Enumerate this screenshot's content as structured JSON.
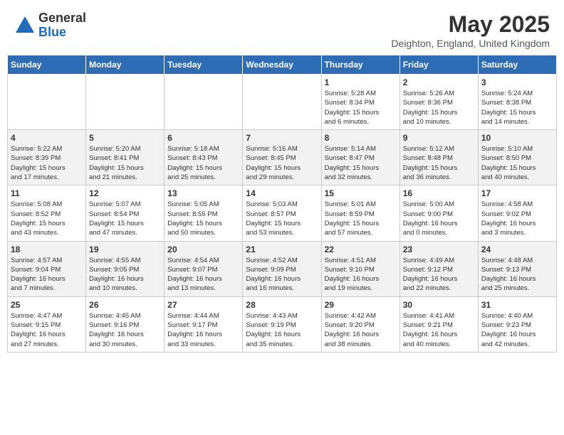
{
  "header": {
    "logo_general": "General",
    "logo_blue": "Blue",
    "title": "May 2025",
    "location": "Deighton, England, United Kingdom"
  },
  "days_of_week": [
    "Sunday",
    "Monday",
    "Tuesday",
    "Wednesday",
    "Thursday",
    "Friday",
    "Saturday"
  ],
  "weeks": [
    [
      {
        "num": "",
        "info": ""
      },
      {
        "num": "",
        "info": ""
      },
      {
        "num": "",
        "info": ""
      },
      {
        "num": "",
        "info": ""
      },
      {
        "num": "1",
        "info": "Sunrise: 5:28 AM\nSunset: 8:34 PM\nDaylight: 15 hours\nand 6 minutes."
      },
      {
        "num": "2",
        "info": "Sunrise: 5:26 AM\nSunset: 8:36 PM\nDaylight: 15 hours\nand 10 minutes."
      },
      {
        "num": "3",
        "info": "Sunrise: 5:24 AM\nSunset: 8:38 PM\nDaylight: 15 hours\nand 14 minutes."
      }
    ],
    [
      {
        "num": "4",
        "info": "Sunrise: 5:22 AM\nSunset: 8:39 PM\nDaylight: 15 hours\nand 17 minutes."
      },
      {
        "num": "5",
        "info": "Sunrise: 5:20 AM\nSunset: 8:41 PM\nDaylight: 15 hours\nand 21 minutes."
      },
      {
        "num": "6",
        "info": "Sunrise: 5:18 AM\nSunset: 8:43 PM\nDaylight: 15 hours\nand 25 minutes."
      },
      {
        "num": "7",
        "info": "Sunrise: 5:16 AM\nSunset: 8:45 PM\nDaylight: 15 hours\nand 29 minutes."
      },
      {
        "num": "8",
        "info": "Sunrise: 5:14 AM\nSunset: 8:47 PM\nDaylight: 15 hours\nand 32 minutes."
      },
      {
        "num": "9",
        "info": "Sunrise: 5:12 AM\nSunset: 8:48 PM\nDaylight: 15 hours\nand 36 minutes."
      },
      {
        "num": "10",
        "info": "Sunrise: 5:10 AM\nSunset: 8:50 PM\nDaylight: 15 hours\nand 40 minutes."
      }
    ],
    [
      {
        "num": "11",
        "info": "Sunrise: 5:08 AM\nSunset: 8:52 PM\nDaylight: 15 hours\nand 43 minutes."
      },
      {
        "num": "12",
        "info": "Sunrise: 5:07 AM\nSunset: 8:54 PM\nDaylight: 15 hours\nand 47 minutes."
      },
      {
        "num": "13",
        "info": "Sunrise: 5:05 AM\nSunset: 8:55 PM\nDaylight: 15 hours\nand 50 minutes."
      },
      {
        "num": "14",
        "info": "Sunrise: 5:03 AM\nSunset: 8:57 PM\nDaylight: 15 hours\nand 53 minutes."
      },
      {
        "num": "15",
        "info": "Sunrise: 5:01 AM\nSunset: 8:59 PM\nDaylight: 15 hours\nand 57 minutes."
      },
      {
        "num": "16",
        "info": "Sunrise: 5:00 AM\nSunset: 9:00 PM\nDaylight: 16 hours\nand 0 minutes."
      },
      {
        "num": "17",
        "info": "Sunrise: 4:58 AM\nSunset: 9:02 PM\nDaylight: 16 hours\nand 3 minutes."
      }
    ],
    [
      {
        "num": "18",
        "info": "Sunrise: 4:57 AM\nSunset: 9:04 PM\nDaylight: 16 hours\nand 7 minutes."
      },
      {
        "num": "19",
        "info": "Sunrise: 4:55 AM\nSunset: 9:05 PM\nDaylight: 16 hours\nand 10 minutes."
      },
      {
        "num": "20",
        "info": "Sunrise: 4:54 AM\nSunset: 9:07 PM\nDaylight: 16 hours\nand 13 minutes."
      },
      {
        "num": "21",
        "info": "Sunrise: 4:52 AM\nSunset: 9:09 PM\nDaylight: 16 hours\nand 16 minutes."
      },
      {
        "num": "22",
        "info": "Sunrise: 4:51 AM\nSunset: 9:10 PM\nDaylight: 16 hours\nand 19 minutes."
      },
      {
        "num": "23",
        "info": "Sunrise: 4:49 AM\nSunset: 9:12 PM\nDaylight: 16 hours\nand 22 minutes."
      },
      {
        "num": "24",
        "info": "Sunrise: 4:48 AM\nSunset: 9:13 PM\nDaylight: 16 hours\nand 25 minutes."
      }
    ],
    [
      {
        "num": "25",
        "info": "Sunrise: 4:47 AM\nSunset: 9:15 PM\nDaylight: 16 hours\nand 27 minutes."
      },
      {
        "num": "26",
        "info": "Sunrise: 4:45 AM\nSunset: 9:16 PM\nDaylight: 16 hours\nand 30 minutes."
      },
      {
        "num": "27",
        "info": "Sunrise: 4:44 AM\nSunset: 9:17 PM\nDaylight: 16 hours\nand 33 minutes."
      },
      {
        "num": "28",
        "info": "Sunrise: 4:43 AM\nSunset: 9:19 PM\nDaylight: 16 hours\nand 35 minutes."
      },
      {
        "num": "29",
        "info": "Sunrise: 4:42 AM\nSunset: 9:20 PM\nDaylight: 16 hours\nand 38 minutes."
      },
      {
        "num": "30",
        "info": "Sunrise: 4:41 AM\nSunset: 9:21 PM\nDaylight: 16 hours\nand 40 minutes."
      },
      {
        "num": "31",
        "info": "Sunrise: 4:40 AM\nSunset: 9:23 PM\nDaylight: 16 hours\nand 42 minutes."
      }
    ]
  ]
}
